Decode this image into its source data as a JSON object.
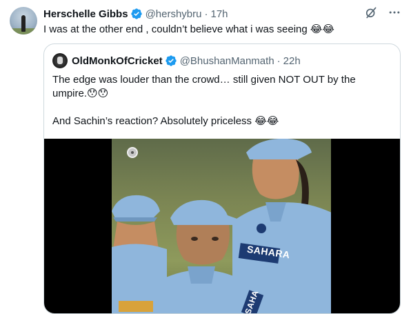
{
  "tweet": {
    "author_name": "Herschelle Gibbs",
    "author_handle": "@hershybru",
    "separator": "·",
    "time": "17h",
    "text": "I was at the other end , couldn’t believe what i was seeing 😂😂"
  },
  "quote": {
    "author_name": "OldMonkOfCricket",
    "author_handle": "@BhushanManmath",
    "separator": "·",
    "time": "22h",
    "text_line1": "The edge was louder than the crowd… still given NOT OUT by the umpire.😯😯",
    "text_line2": "And Sachin’s reaction? Absolutely priceless 😂😂"
  },
  "video": {
    "jersey_text_1": "SAHARA",
    "jersey_text_2": "SAHA"
  },
  "icons": {
    "verified": "verified-badge-icon",
    "grok": "grok-icon",
    "more": "more-options-icon",
    "record": "record-indicator-icon"
  },
  "colors": {
    "verified_blue": "#1d9bf0",
    "text_primary": "#0f1419",
    "text_secondary": "#536471",
    "border": "#cfd9de",
    "jersey_blue": "#8fb6dc"
  }
}
